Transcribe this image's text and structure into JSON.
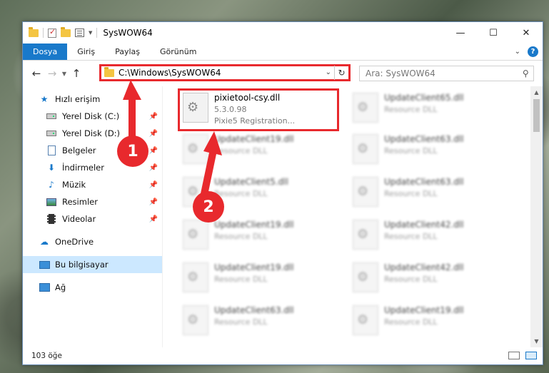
{
  "window": {
    "title": "SysWOW64",
    "controls": {
      "minimize": "—",
      "maximize": "☐",
      "close": "✕"
    }
  },
  "ribbon": {
    "tabs": [
      "Dosya",
      "Giriş",
      "Paylaş",
      "Görünüm"
    ],
    "expand_icon": "⌄",
    "help_icon": "?"
  },
  "address": {
    "path": "C:\\Windows\\SysWOW64",
    "search_placeholder": "Ara: SysWOW64"
  },
  "nav_buttons": {
    "back": "←",
    "forward": "→",
    "up": "↑"
  },
  "sidebar": {
    "quick_access": "Hızlı erişim",
    "items": [
      {
        "label": "Yerel Disk (C:)",
        "pin": "📌"
      },
      {
        "label": "Yerel Disk (D:)",
        "pin": "📌"
      },
      {
        "label": "Belgeler",
        "pin": "📌"
      },
      {
        "label": "İndirmeler",
        "pin": "📌"
      },
      {
        "label": "Müzik",
        "pin": "📌"
      },
      {
        "label": "Resimler",
        "pin": "📌"
      },
      {
        "label": "Videolar",
        "pin": "📌"
      }
    ],
    "onedrive": "OneDrive",
    "this_pc": "Bu bilgisayar",
    "network": "Ağ"
  },
  "files": {
    "highlighted": {
      "name": "pixietool-csy.dll",
      "version": "5.3.0.98",
      "description": "Pixie5 Registration..."
    },
    "left_column": [
      {
        "name": "UpdateClient19.dll",
        "type": "Resource DLL"
      },
      {
        "name": "UpdateClient5.dll",
        "type": "Resource DLL"
      },
      {
        "name": "UpdateClient19.dll",
        "type": "Resource DLL"
      },
      {
        "name": "UpdateClient19.dll",
        "type": "Resource DLL"
      },
      {
        "name": "UpdateClient63.dll",
        "type": "Resource DLL"
      }
    ],
    "right_column": [
      {
        "name": "UpdateClient65.dll",
        "type": "Resource DLL"
      },
      {
        "name": "UpdateClient63.dll",
        "type": "Resource DLL"
      },
      {
        "name": "UpdateClient63.dll",
        "type": "Resource DLL"
      },
      {
        "name": "UpdateClient42.dll",
        "type": "Resource DLL"
      },
      {
        "name": "UpdateClient42.dll",
        "type": "Resource DLL"
      },
      {
        "name": "UpdateClient19.dll",
        "type": "Resource DLL"
      }
    ]
  },
  "status": {
    "count": "103 öğe"
  },
  "markers": {
    "one": "1",
    "two": "2"
  },
  "colors": {
    "accent": "#1979ca",
    "highlight": "#e8292d",
    "selected": "#cce8ff"
  }
}
